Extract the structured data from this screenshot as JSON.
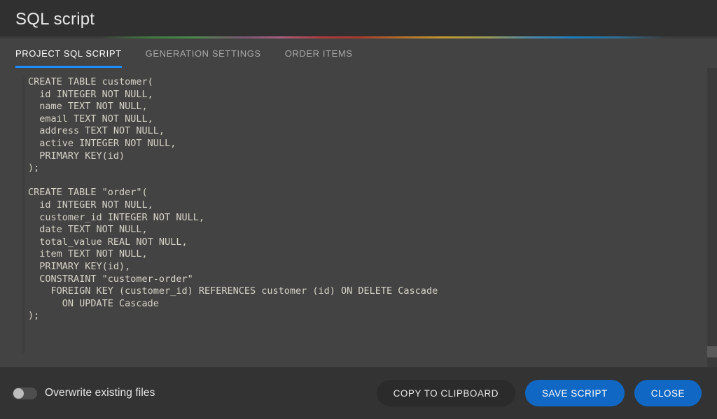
{
  "window": {
    "title": "SQL script"
  },
  "tabs": [
    {
      "label": "PROJECT SQL SCRIPT",
      "active": true
    },
    {
      "label": "GENERATION SETTINGS",
      "active": false
    },
    {
      "label": "ORDER ITEMS",
      "active": false
    }
  ],
  "editor": {
    "content": "CREATE TABLE customer(\n  id INTEGER NOT NULL,\n  name TEXT NOT NULL,\n  email TEXT NOT NULL,\n  address TEXT NOT NULL,\n  active INTEGER NOT NULL,\n  PRIMARY KEY(id)\n);\n\nCREATE TABLE \"order\"(\n  id INTEGER NOT NULL,\n  customer_id INTEGER NOT NULL,\n  date TEXT NOT NULL,\n  total_value REAL NOT NULL,\n  item TEXT NOT NULL,\n  PRIMARY KEY(id),\n  CONSTRAINT \"customer-order\"\n    FOREIGN KEY (customer_id) REFERENCES customer (id) ON DELETE Cascade\n      ON UPDATE Cascade\n);",
    "read_only": false
  },
  "footer": {
    "overwrite_toggle": {
      "label": "Overwrite existing files",
      "state": "off"
    },
    "buttons": {
      "copy": "COPY TO CLIPBOARD",
      "save": "SAVE SCRIPT",
      "close": "CLOSE"
    }
  },
  "colors": {
    "accent_blue": "#1a8cff",
    "primary_button": "#1168c4",
    "header_bg": "#303030",
    "panel_bg": "#434343",
    "footer_bg": "#333333",
    "code_text": "#d6d3c7"
  }
}
